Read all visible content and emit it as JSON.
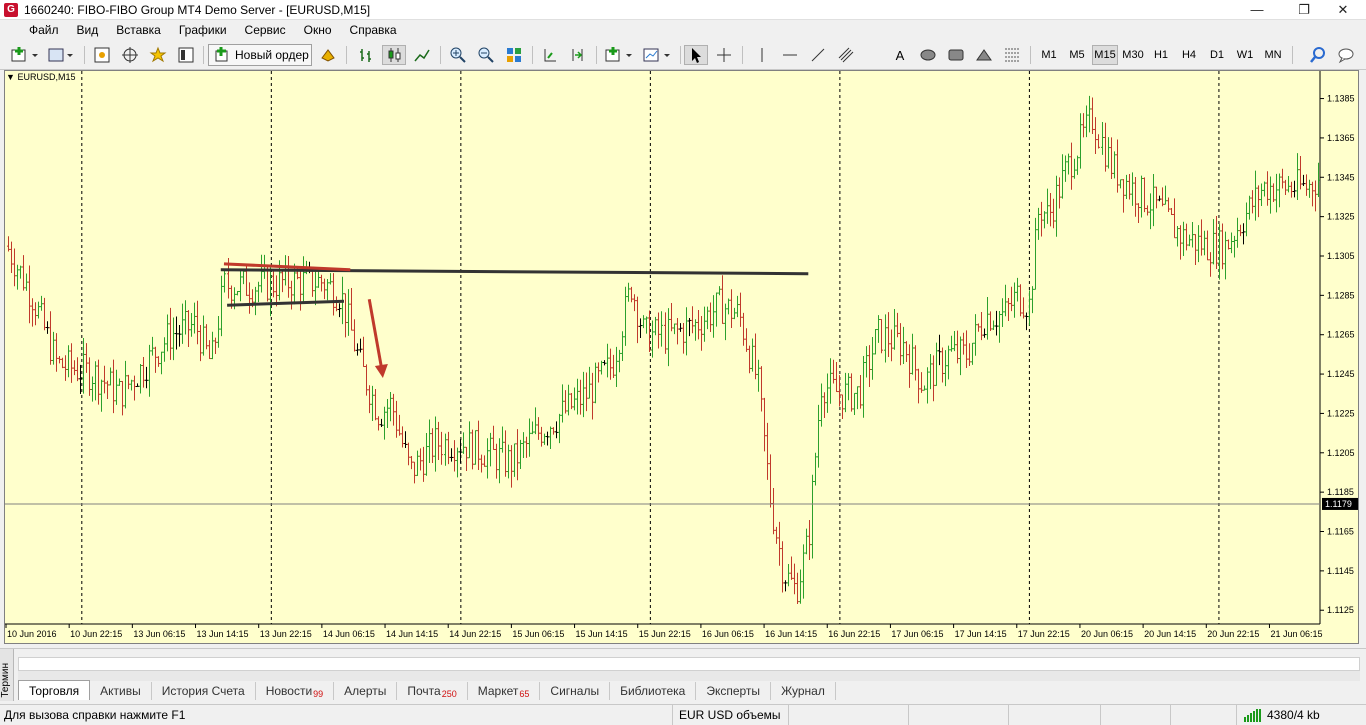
{
  "window": {
    "title": "1660240: FIBO-FIBO Group MT4 Demo Server - [EURUSD,M15]",
    "app_icon_glyph": "G",
    "controls": [
      "minimize-icon",
      "restore-icon",
      "close-icon"
    ]
  },
  "menu": [
    "Файл",
    "Вид",
    "Вставка",
    "Графики",
    "Сервис",
    "Окно",
    "Справка"
  ],
  "toolbar": {
    "new_order_label": "Новый ордер",
    "timeframes": [
      "M1",
      "M5",
      "M15",
      "M30",
      "H1",
      "H4",
      "D1",
      "W1",
      "MN"
    ],
    "active_timeframe": "M15",
    "text_tool_label": "A",
    "icons": [
      "new-chart-icon",
      "profiles-icon",
      "market-watch-icon",
      "navigator-icon",
      "favorites-icon",
      "data-window-icon",
      "new-order-icon",
      "autotrading-icon",
      "bar-chart-icon",
      "candlestick-icon",
      "line-chart-icon",
      "zoom-in-icon",
      "zoom-out-icon",
      "tile-windows-icon",
      "chart-shift-icon",
      "auto-scroll-icon",
      "indicators-icon",
      "templates-icon",
      "cursor-icon",
      "crosshair-icon",
      "vertical-line-icon",
      "horizontal-line-icon",
      "trendline-icon",
      "channel-icon",
      "text-icon",
      "ellipse-icon",
      "rectangle-icon",
      "triangle-icon",
      "fibonacci-icon",
      "search-icon",
      "chat-icon"
    ]
  },
  "chart": {
    "symbol_label": "EURUSD,M15",
    "current_price": "1.1179",
    "price_ticks": [
      "1.1385",
      "1.1365",
      "1.1345",
      "1.1325",
      "1.1305",
      "1.1285",
      "1.1265",
      "1.1245",
      "1.1225",
      "1.1205",
      "1.1185",
      "1.1165",
      "1.1145",
      "1.1125"
    ],
    "time_ticks": [
      "10 Jun 2016",
      "10 Jun 22:15",
      "13 Jun 06:15",
      "13 Jun 14:15",
      "13 Jun 22:15",
      "14 Jun 06:15",
      "14 Jun 14:15",
      "14 Jun 22:15",
      "15 Jun 06:15",
      "15 Jun 14:15",
      "15 Jun 22:15",
      "16 Jun 06:15",
      "16 Jun 14:15",
      "16 Jun 22:15",
      "17 Jun 06:15",
      "17 Jun 14:15",
      "17 Jun 22:15",
      "20 Jun 06:15",
      "20 Jun 14:15",
      "20 Jun 22:15",
      "21 Jun 06:15"
    ],
    "colors": {
      "background": "#ffffcc",
      "bull_bar": "#2ca02c",
      "bear_bar": "#c0392b",
      "neutral_bar": "#000000",
      "resistance_line": "#333333",
      "red_trendline": "#c0392b",
      "arrow": "#c0392b",
      "price_label_bg": "#000000"
    }
  },
  "chart_data": {
    "type": "ohlc",
    "symbol": "EURUSD",
    "timeframe": "M15",
    "y_min": 1.1118,
    "y_max": 1.1399,
    "x_domain": [
      0,
      20.8
    ],
    "price_path_knots": [
      [
        0,
        1.131
      ],
      [
        0.4,
        1.1285
      ],
      [
        0.8,
        1.125
      ],
      [
        1.4,
        1.1245
      ],
      [
        1.8,
        1.1235
      ],
      [
        2.2,
        1.125
      ],
      [
        2.6,
        1.1265
      ],
      [
        3.0,
        1.127
      ],
      [
        3.25,
        1.125
      ],
      [
        3.45,
        1.129
      ],
      [
        3.7,
        1.129
      ],
      [
        4.0,
        1.129
      ],
      [
        4.5,
        1.1292
      ],
      [
        5.0,
        1.1292
      ],
      [
        5.3,
        1.1285
      ],
      [
        5.6,
        1.125
      ],
      [
        5.9,
        1.1225
      ],
      [
        6.1,
        1.123
      ],
      [
        6.4,
        1.1195
      ],
      [
        6.8,
        1.121
      ],
      [
        7.2,
        1.121
      ],
      [
        7.6,
        1.1205
      ],
      [
        8.0,
        1.12
      ],
      [
        8.4,
        1.1215
      ],
      [
        8.8,
        1.1225
      ],
      [
        9.2,
        1.1235
      ],
      [
        9.6,
        1.125
      ],
      [
        9.9,
        1.129
      ],
      [
        10.1,
        1.1265
      ],
      [
        10.5,
        1.1265
      ],
      [
        10.9,
        1.127
      ],
      [
        11.3,
        1.128
      ],
      [
        11.6,
        1.1275
      ],
      [
        11.9,
        1.124
      ],
      [
        12.1,
        1.118
      ],
      [
        12.3,
        1.1145
      ],
      [
        12.5,
        1.1135
      ],
      [
        12.7,
        1.116
      ],
      [
        12.9,
        1.124
      ],
      [
        13.2,
        1.1235
      ],
      [
        13.5,
        1.1235
      ],
      [
        13.8,
        1.1265
      ],
      [
        14.2,
        1.126
      ],
      [
        14.5,
        1.124
      ],
      [
        14.9,
        1.1255
      ],
      [
        15.2,
        1.1255
      ],
      [
        15.5,
        1.1275
      ],
      [
        15.8,
        1.1275
      ],
      [
        16.0,
        1.1285
      ],
      [
        16.2,
        1.128
      ],
      [
        16.35,
        1.133
      ],
      [
        16.5,
        1.1325
      ],
      [
        16.8,
        1.135
      ],
      [
        17.2,
        1.1375
      ],
      [
        17.5,
        1.135
      ],
      [
        17.8,
        1.134
      ],
      [
        18.2,
        1.133
      ],
      [
        18.6,
        1.1315
      ],
      [
        19.0,
        1.131
      ],
      [
        19.3,
        1.131
      ],
      [
        19.6,
        1.1325
      ],
      [
        19.9,
        1.134
      ],
      [
        20.3,
        1.134
      ],
      [
        20.6,
        1.134
      ],
      [
        20.8,
        1.1345
      ]
    ],
    "annotations": {
      "resistance_line": {
        "from": [
          3.4,
          1.1298
        ],
        "to": [
          12.7,
          1.1296
        ]
      },
      "red_line": {
        "from": [
          3.45,
          1.1301
        ],
        "to": [
          5.45,
          1.1298
        ]
      },
      "lower_line": {
        "from": [
          3.5,
          1.128
        ],
        "to": [
          5.35,
          1.1282
        ]
      },
      "arrow": {
        "from": [
          5.75,
          1.1283
        ],
        "to": [
          5.95,
          1.1243
        ]
      },
      "current_price_line": 1.1179
    }
  },
  "terminal": {
    "side_label": "Термин",
    "tabs": [
      {
        "label": "Торговля",
        "badge": ""
      },
      {
        "label": "Активы",
        "badge": ""
      },
      {
        "label": "История Счета",
        "badge": ""
      },
      {
        "label": "Новости",
        "badge": "99"
      },
      {
        "label": "Алерты",
        "badge": ""
      },
      {
        "label": "Почта",
        "badge": "250"
      },
      {
        "label": "Маркет",
        "badge": "65"
      },
      {
        "label": "Сигналы",
        "badge": ""
      },
      {
        "label": "Библиотека",
        "badge": ""
      },
      {
        "label": "Эксперты",
        "badge": ""
      },
      {
        "label": "Журнал",
        "badge": ""
      }
    ],
    "active_tab": "Торговля"
  },
  "status": {
    "help_text": "Для вызова справки нажмите F1",
    "profile": "EUR USD объемы",
    "traffic": "4380/4 kb"
  }
}
